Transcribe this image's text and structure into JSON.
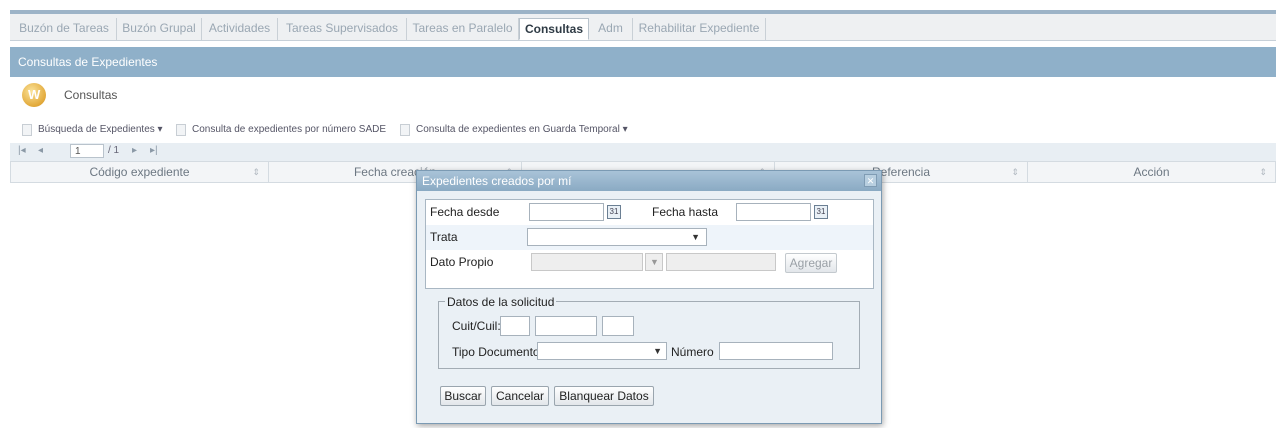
{
  "tabs": [
    {
      "label": "Buzón de Tareas",
      "active": false
    },
    {
      "label": "Buzón Grupal",
      "active": false
    },
    {
      "label": "Actividades",
      "active": false
    },
    {
      "label": "Tareas Supervisados",
      "active": false
    },
    {
      "label": "Tareas en Paralelo",
      "active": false
    },
    {
      "label": "Consultas",
      "active": true
    },
    {
      "label": "Adm",
      "active": false
    },
    {
      "label": "Rehabilitar Expediente",
      "active": false
    }
  ],
  "panel": {
    "title": "Consultas de Expedientes",
    "section": "Consultas"
  },
  "toolbar": {
    "items": [
      {
        "label": "Búsqueda de Expedientes",
        "dropdown": true
      },
      {
        "label": "Consulta de expedientes por número SADE",
        "dropdown": false
      },
      {
        "label": "Consulta de expedientes en Guarda Temporal",
        "dropdown": true
      }
    ]
  },
  "pager": {
    "first": "|◂",
    "prev": "◂",
    "page": "1",
    "total": "/ 1",
    "next": "▸",
    "last": "▸|"
  },
  "grid": {
    "columns": [
      "Código expediente",
      "Fecha creación",
      "",
      "Referencia",
      "Acción"
    ]
  },
  "dialog": {
    "title": "Expedientes creados por mí",
    "fecha_desde_label": "Fecha desde",
    "fecha_hasta_label": "Fecha hasta",
    "trata_label": "Trata",
    "dato_propio_label": "Dato Propio",
    "agregar": "Agregar",
    "solicitud_legend": "Datos de la solicitud",
    "cuit_label": "Cuit/Cuil:",
    "tipo_documento_label": "Tipo Documento",
    "numero_label": "Número",
    "buscar": "Buscar",
    "cancelar": "Cancelar",
    "blanquear": "Blanquear Datos",
    "close_icon": "close-icon",
    "calendar_icon": "calendar-icon"
  },
  "colors": {
    "header": "#8fb0c9",
    "dialog_title": "#9bb8cf"
  }
}
